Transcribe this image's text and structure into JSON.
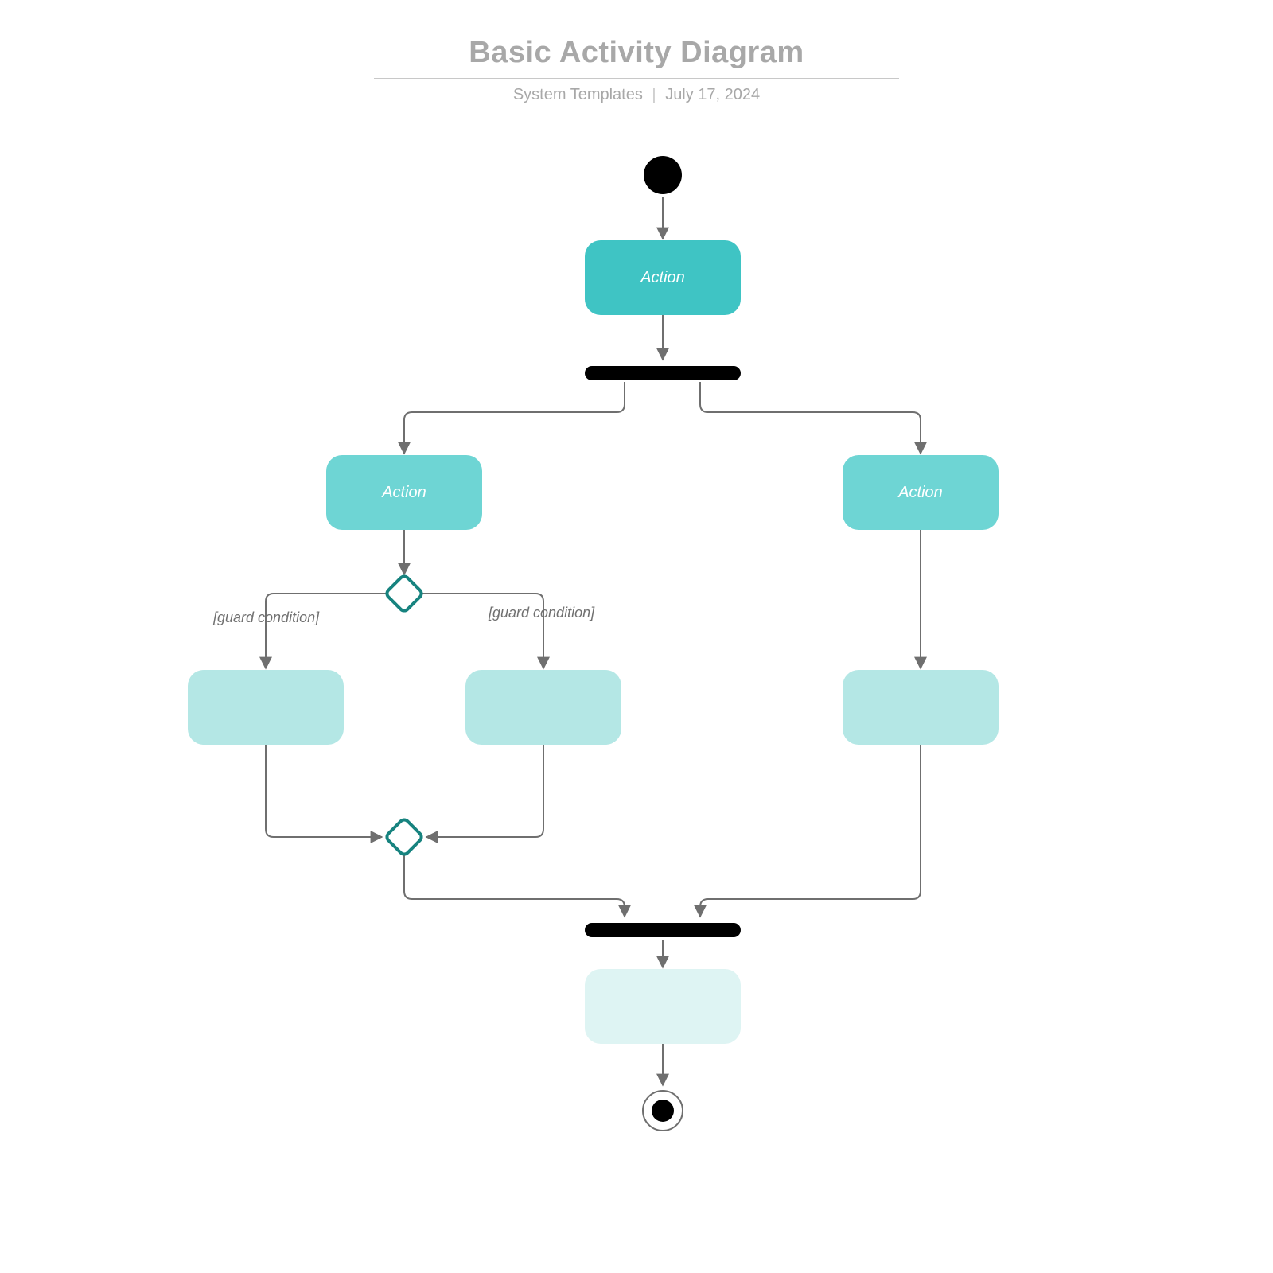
{
  "header": {
    "title": "Basic Activity Diagram",
    "subtitle_left": "System Templates",
    "subtitle_sep": "|",
    "subtitle_right": "July 17, 2024"
  },
  "nodes": {
    "action_top": "Action",
    "action_left": "Action",
    "action_right": "Action",
    "action_light1": "",
    "action_light2": "",
    "action_light3": "",
    "action_pale": ""
  },
  "labels": {
    "guard_left": "[guard condition]",
    "guard_right": "[guard condition]"
  },
  "colors": {
    "teal_strong": "#3fc4c4",
    "teal_mid": "#6ed5d4",
    "teal_light": "#b4e7e5",
    "teal_pale": "#def4f3",
    "stroke": "#6f6f6f",
    "decision_border": "#17837f"
  }
}
